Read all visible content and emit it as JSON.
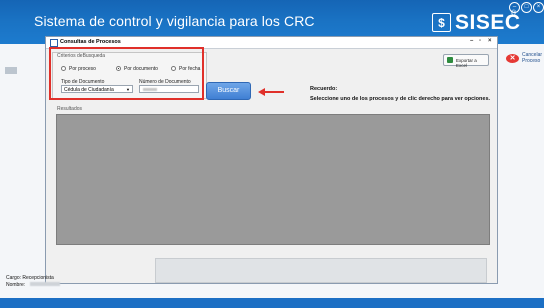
{
  "app": {
    "title": "Sistema de control y vigilancia para los CRC",
    "brand": "SISEC",
    "brand_mark": "®",
    "window_controls": [
      "–",
      "□",
      "×"
    ]
  },
  "side_panel": {
    "cancel_label": "Cancelar Proceso"
  },
  "dialog": {
    "title": "Consultas de Procesos",
    "controls": [
      "–",
      "▫",
      "×"
    ],
    "criteria_legend": "Criterios deBusqueda",
    "radios": [
      {
        "label": "Por proceso",
        "checked": false
      },
      {
        "label": "Por documento",
        "checked": true
      },
      {
        "label": "Por fecha",
        "checked": false
      }
    ],
    "doc_type_label": "Tipo de Documento",
    "doc_type_value": "Cédula de Ciudadanía",
    "doc_number_label": "Número de Documento",
    "search_button": "Buscar",
    "export_button": "Exportar a Excel",
    "reminder_title": "Recuerdo:",
    "reminder_text": "Seleccione uno de los procesos y de clic derecho para ver opciones.",
    "results_legend": "Resultados"
  },
  "footer": {
    "cargo": "Cargo: Recepcionista",
    "nombre_label": "Nombre:"
  },
  "colors": {
    "header_blue": "#1a73c4",
    "highlight_red": "#e0302a",
    "results_gray": "#9a9a9a"
  }
}
